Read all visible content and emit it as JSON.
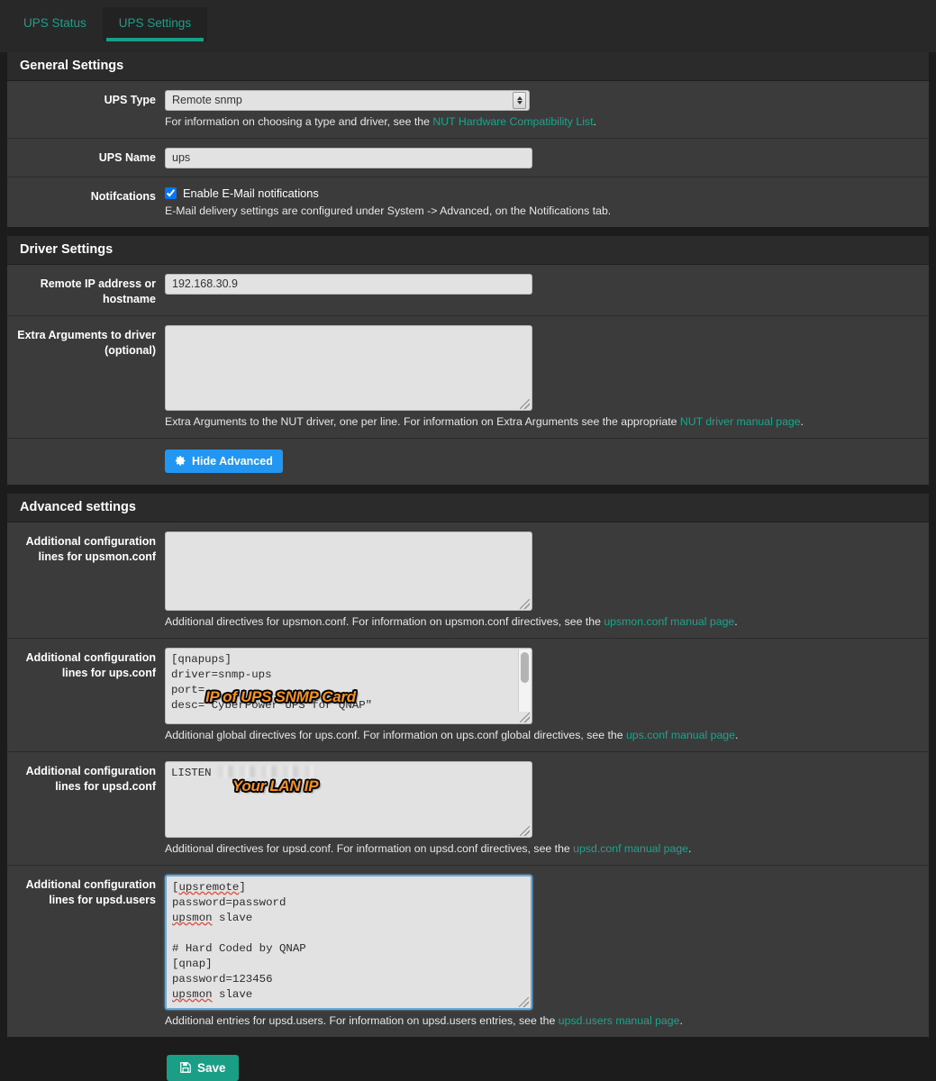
{
  "tabs": [
    {
      "label": "UPS Status",
      "active": false
    },
    {
      "label": "UPS Settings",
      "active": true
    }
  ],
  "general": {
    "title": "General Settings",
    "ups_type": {
      "label": "UPS Type",
      "value": "Remote snmp",
      "help_pre": "For information on choosing a type and driver, see the ",
      "help_link": "NUT Hardware Compatibility List",
      "help_post": "."
    },
    "ups_name": {
      "label": "UPS Name",
      "value": "ups",
      "placeholder": ""
    },
    "notifications": {
      "label": "Notifcations",
      "checkbox_label": "Enable E-Mail notifications",
      "checked": true,
      "help": "E-Mail delivery settings are configured under System -> Advanced, on the Notifications tab."
    }
  },
  "driver": {
    "title": "Driver Settings",
    "remote_ip": {
      "label": "Remote IP address or hostname",
      "value": "192.168.30.9",
      "placeholder": ""
    },
    "extra_args": {
      "label": "Extra Arguments to driver (optional)",
      "value": "",
      "help_pre": "Extra Arguments to the NUT driver, one per line. For information on Extra Arguments see the appropriate ",
      "help_link": "NUT driver manual page",
      "help_post": "."
    },
    "advanced_button": "Hide Advanced"
  },
  "advanced": {
    "title": "Advanced settings",
    "upsmon_conf": {
      "label": "Additional configuration lines for upsmon.conf",
      "value": "",
      "help_pre": "Additional directives for upsmon.conf. For information on upsmon.conf directives, see the ",
      "help_link": "upsmon.conf manual page",
      "help_post": "."
    },
    "ups_conf": {
      "label": "Additional configuration lines for ups.conf",
      "lines": [
        "[qnapups]",
        "driver=snmp-ups",
        "port=",
        "desc=\"CyberPower UPS for QNAP\""
      ],
      "annotation": "IP of UPS SNMP Card",
      "help_pre": "Additional global directives for ups.conf. For information on ups.conf global directives, see the ",
      "help_link": "ups.conf manual page",
      "help_post": "."
    },
    "upsd_conf": {
      "label": "Additional configuration lines for upsd.conf",
      "line_prefix": "LISTEN ",
      "redacted_value": true,
      "annotation": "Your LAN IP",
      "help_pre": "Additional directives for upsd.conf. For information on upsd.conf directives, see the ",
      "help_link": "upsd.conf manual page",
      "help_post": "."
    },
    "upsd_users": {
      "label": "Additional configuration lines for upsd.users",
      "lines": [
        "[upsremote]",
        "password=password",
        "upsmon slave",
        "",
        "# Hard Coded by QNAP",
        "[qnap]",
        "password=123456",
        "upsmon slave"
      ],
      "focused": true,
      "help_pre": "Additional entries for upsd.users. For information on upsd.users entries, see the ",
      "help_link": "upsd.users manual page",
      "help_post": "."
    }
  },
  "footer": {
    "save_label": "Save"
  },
  "colors": {
    "accent_teal": "#16a085",
    "link_teal": "#1fa38b",
    "button_blue": "#2196f3",
    "save_green": "#1b9e86",
    "annotation_orange": "#F7941E",
    "page_bg": "#1c1c1c",
    "panel_bg": "#3b3b3b",
    "panel_head_bg": "#2b2b2b"
  }
}
